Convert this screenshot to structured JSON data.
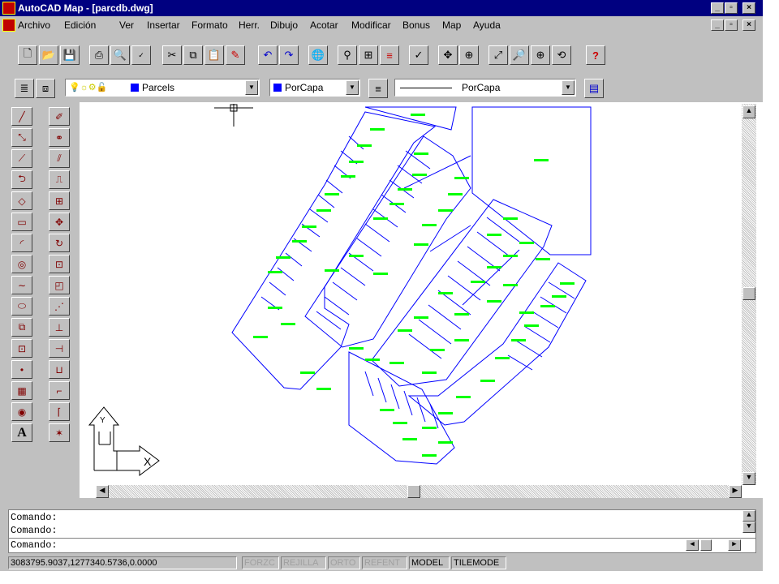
{
  "window": {
    "title": "AutoCAD Map - [parcdb.dwg]"
  },
  "menu": {
    "items": [
      "Archivo",
      "Edición",
      "Ver",
      "Insertar",
      "Formato",
      "Herr.",
      "Dibujo",
      "Acotar",
      "Modificar",
      "Bonus",
      "Map",
      "Ayuda"
    ]
  },
  "layer_toolbar": {
    "layer": "Parcels",
    "color": "PorCapa",
    "linetype": "PorCapa"
  },
  "command": {
    "lines": [
      "Comando:",
      "Comando:",
      "Comando:"
    ]
  },
  "status": {
    "coords": "3083795.9037,1277340.5736,0.0000",
    "toggles": [
      {
        "label": "FORZC",
        "active": false
      },
      {
        "label": "REJILLA",
        "active": false
      },
      {
        "label": "ORTO",
        "active": false
      },
      {
        "label": "REFENT",
        "active": false
      },
      {
        "label": "MODEL",
        "active": true
      },
      {
        "label": "TILEMODE",
        "active": true
      }
    ]
  },
  "drawing": {
    "ucs_x": "X",
    "ucs_y": "Y"
  },
  "colors": {
    "titlebar": "#000080",
    "parcel_line": "#0000ff",
    "parcel_label": "#00ff00"
  }
}
